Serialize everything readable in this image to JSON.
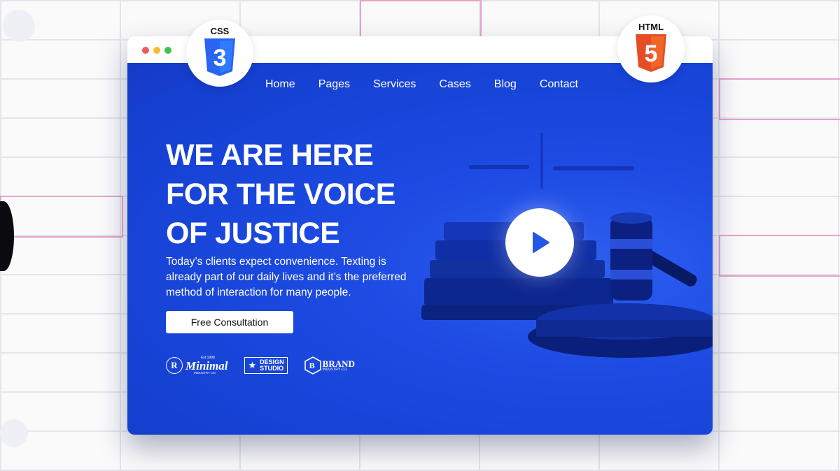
{
  "nav": {
    "items": [
      {
        "label": "Home"
      },
      {
        "label": "Pages"
      },
      {
        "label": "Services"
      },
      {
        "label": "Cases"
      },
      {
        "label": "Blog"
      },
      {
        "label": "Contact"
      }
    ]
  },
  "hero": {
    "headline": [
      "WE ARE HERE",
      "FOR THE VOICE",
      "OF JUSTICE"
    ],
    "subtext": "Today’s clients expect convenience. Texting is already part of our daily lives and it’s the preferred method of interaction for many people.",
    "cta_label": "Free Consultation"
  },
  "partners": {
    "minimal": {
      "mark": "R",
      "est": "Est.1998",
      "name": "Minimal",
      "sub": "INDUSTRY CO."
    },
    "design": {
      "line1": "DESIGN",
      "line2": "STUDIO"
    },
    "brand": {
      "mark": "B",
      "name": "BRAND",
      "sub": "INDUSTRY CO."
    }
  },
  "badges": {
    "css": {
      "label": "CSS",
      "glyph": "3"
    },
    "html": {
      "label": "HTML",
      "glyph": "5"
    }
  },
  "icons": {
    "play": "play-icon",
    "css": "css3-shield-icon",
    "html": "html5-shield-icon",
    "gavel": "gavel-icon",
    "scales": "scales-icon",
    "books": "books-icon"
  },
  "colors": {
    "hero_blue": "#1d4be3",
    "play_blue": "#2457e6",
    "css_blue": "#2965f1",
    "html_orange": "#e44d26",
    "close": "#f05a57",
    "minimize": "#f6bd30",
    "maximize": "#3fc34c"
  }
}
